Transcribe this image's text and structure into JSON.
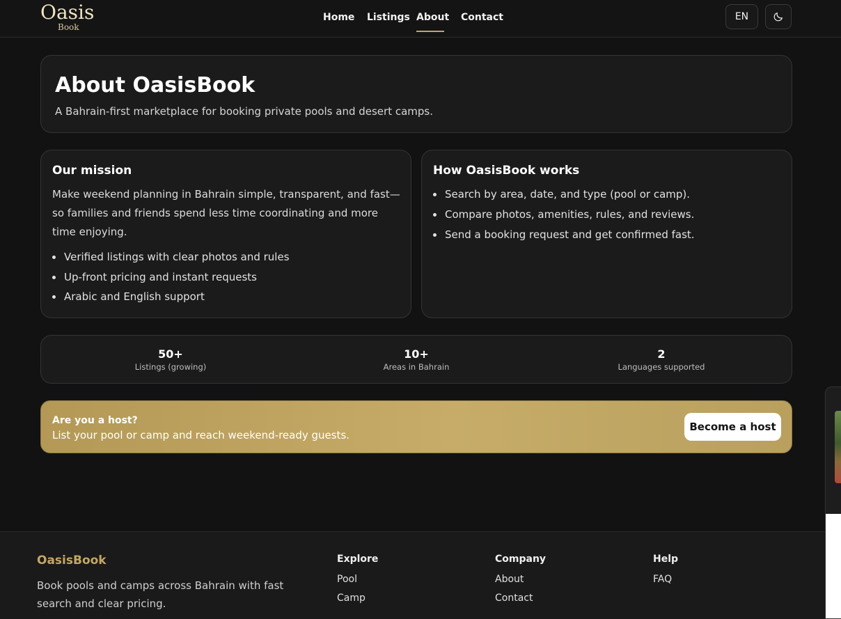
{
  "header": {
    "logo_main": "Oasis",
    "logo_sub": "Book",
    "nav": [
      {
        "label": "Home"
      },
      {
        "label": "Listings"
      },
      {
        "label": "About"
      },
      {
        "label": "Contact"
      }
    ],
    "active_nav": "About",
    "language_label": "EN",
    "theme_icon": "moon-icon"
  },
  "hero": {
    "title": "About OasisBook",
    "subtitle": "A Bahrain-first marketplace for booking private pools and desert camps."
  },
  "mission": {
    "heading": "Our mission",
    "text": "Make weekend planning in Bahrain simple, transparent, and fast—so families and friends spend less time coordinating and more time enjoying.",
    "points": [
      "Verified listings with clear photos and rules",
      "Up-front pricing and instant requests",
      "Arabic and English support"
    ]
  },
  "how": {
    "heading": "How OasisBook works",
    "steps": [
      "Search by area, date, and type (pool or camp).",
      "Compare photos, amenities, rules, and reviews.",
      "Send a booking request and get confirmed fast."
    ]
  },
  "stats": [
    {
      "value": "50+",
      "label": "Listings (growing)"
    },
    {
      "value": "10+",
      "label": "Areas in Bahrain"
    },
    {
      "value": "2",
      "label": "Languages supported"
    }
  ],
  "host": {
    "question": "Are you a host?",
    "text": "List your pool or camp and reach weekend-ready guests.",
    "button": "Become a host"
  },
  "footer": {
    "brand": "OasisBook",
    "description": "Book pools and camps across Bahrain with fast search and clear pricing.",
    "columns": [
      {
        "heading": "Explore",
        "links": [
          "Pool",
          "Camp"
        ]
      },
      {
        "heading": "Company",
        "links": [
          "About",
          "Contact"
        ]
      },
      {
        "heading": "Help",
        "links": [
          "FAQ"
        ]
      }
    ]
  },
  "colors": {
    "background": "#121212",
    "card": "#1b1b1b",
    "accent_gold": "#c4a764",
    "text": "#ffffff"
  }
}
